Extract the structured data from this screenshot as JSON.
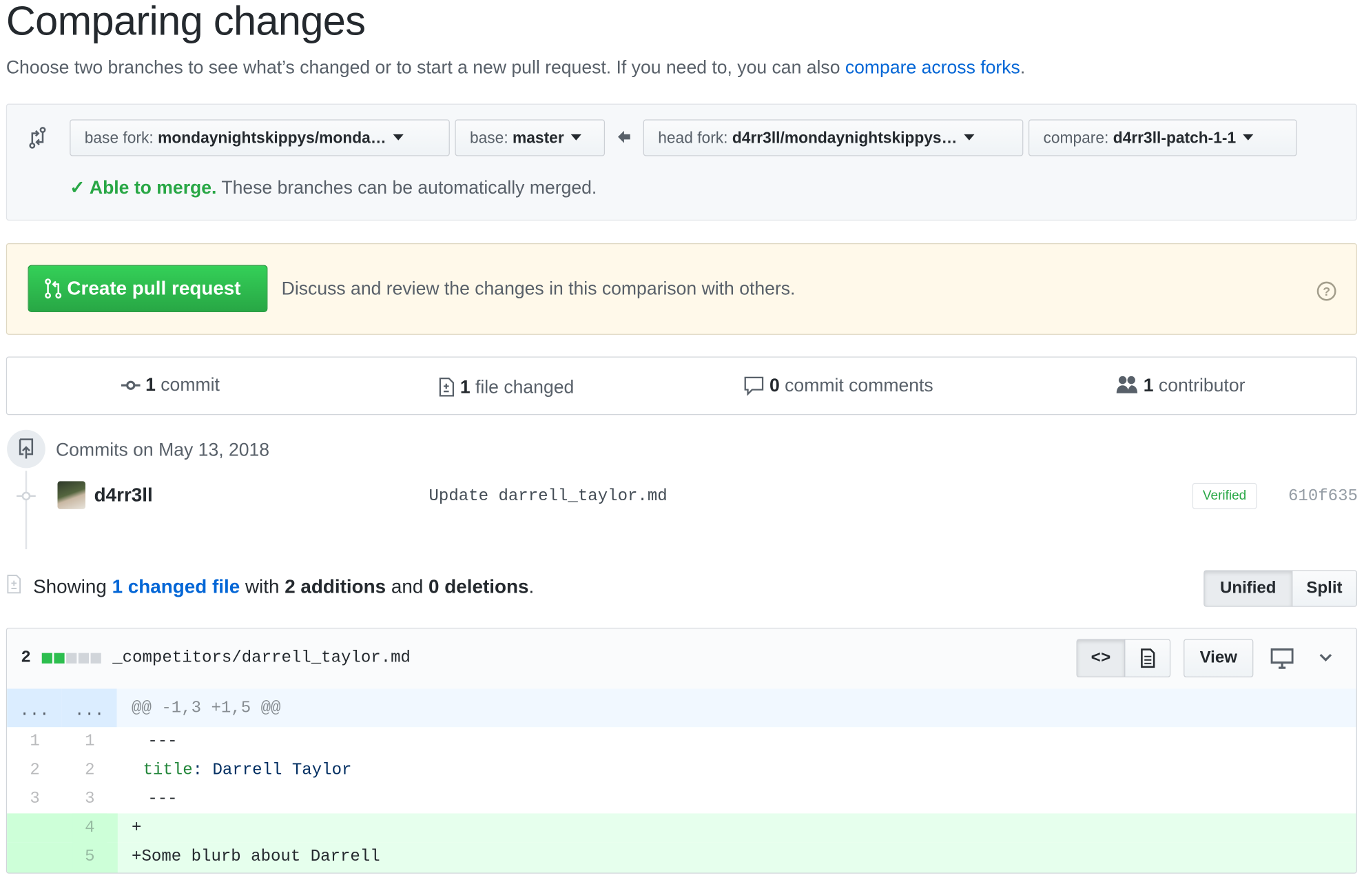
{
  "page": {
    "title": "Comparing changes",
    "subtitle": "Choose two branches to see what’s changed or to start a new pull request. If you need to, you can also ",
    "subtitle_link": "compare across forks",
    "subtitle_end": "."
  },
  "range": {
    "base_fork_label": "base fork:",
    "base_fork_value": "mondaynightskippys/monda…",
    "base_label": "base:",
    "base_value": "master",
    "head_fork_label": "head fork:",
    "head_fork_value": "d4rr3ll/mondaynightskippys…",
    "compare_label": "compare:",
    "compare_value": "d4rr3ll-patch-1-1",
    "merge_status": "Able to merge.",
    "merge_text": " These branches can be automatically merged."
  },
  "pr": {
    "button": "Create pull request",
    "text": "Discuss and review the changes in this comparison with others."
  },
  "stats": {
    "commits_count": "1",
    "commits_label": " commit",
    "files_count": "1",
    "files_label": " file changed",
    "comments_count": "0",
    "comments_label": " commit comments",
    "contributors_count": "1",
    "contributors_label": " contributor"
  },
  "commits": {
    "heading": "Commits on May 13, 2018",
    "items": [
      {
        "author": "d4rr3ll",
        "message": "Update darrell_taylor.md",
        "badge": "Verified",
        "sha": "610f635"
      }
    ]
  },
  "summary": {
    "prefix": "Showing ",
    "link": "1 changed file",
    "mid": " with ",
    "additions": "2 additions",
    "and": " and ",
    "deletions": "0 deletions",
    "end": ".",
    "unified": "Unified",
    "split": "Split"
  },
  "file": {
    "changes": "2",
    "name": "_competitors/darrell_taylor.md",
    "view_button": "View",
    "hunk_left": "...",
    "hunk_right": "...",
    "hunk": "@@ -1,3 +1,5 @@",
    "lines": [
      {
        "old": "1",
        "new": "1",
        "text": " ---",
        "type": "context"
      },
      {
        "old": "2",
        "new": "2",
        "key": "title",
        "rest": ": Darrell Taylor",
        "type": "context"
      },
      {
        "old": "3",
        "new": "3",
        "text": " ---",
        "type": "context"
      },
      {
        "old": "",
        "new": "4",
        "text": "+",
        "type": "add"
      },
      {
        "old": "",
        "new": "5",
        "text": "+Some blurb about Darrell",
        "type": "add"
      }
    ]
  },
  "colors": {
    "accent": "#0366d6",
    "success": "#28a745",
    "addition_bg": "#e6ffed"
  }
}
